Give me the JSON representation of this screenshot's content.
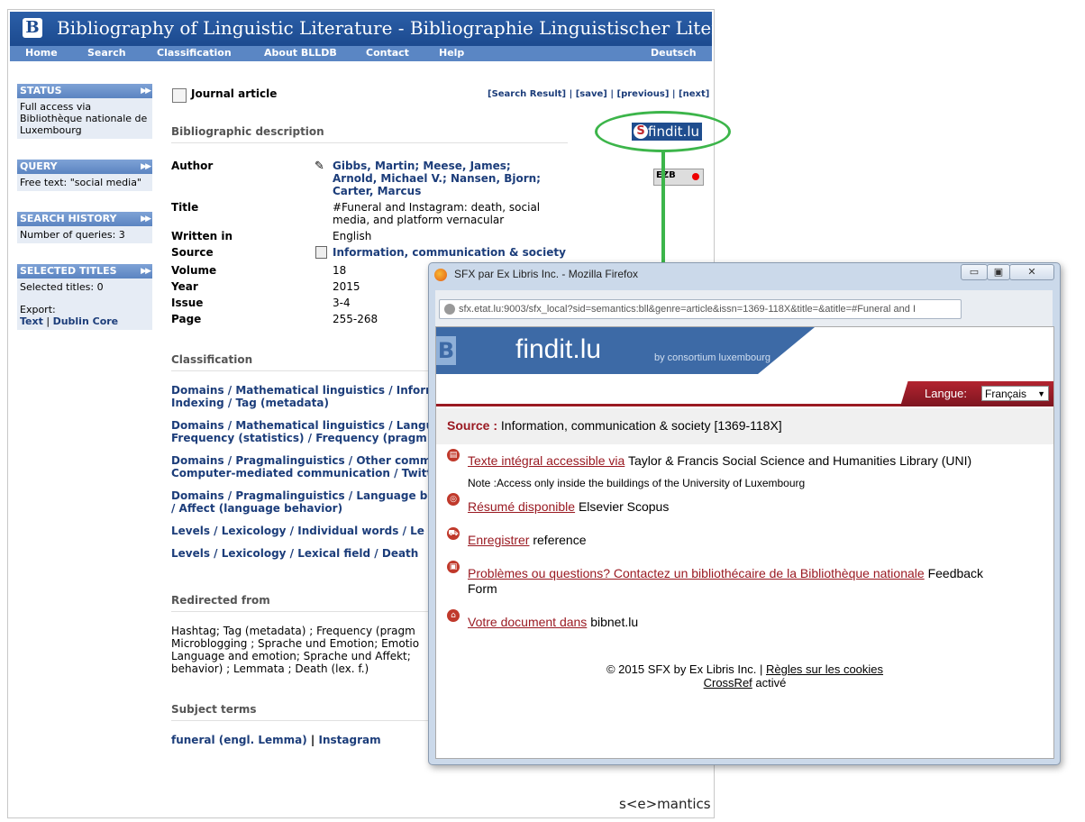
{
  "site": {
    "title": "Bibliography of Linguistic Literature - Bibliographie Linguistischer Literatur",
    "logo": "B"
  },
  "nav": {
    "home": "Home",
    "search": "Search",
    "classification": "Classification",
    "about": "About BLLDB",
    "contact": "Contact",
    "help": "Help",
    "lang": "Deutsch"
  },
  "sidebar": {
    "status": {
      "title": "STATUS",
      "text": "Full access via Bibliothèque nationale de Luxembourg"
    },
    "query": {
      "title": "QUERY",
      "text": "Free text: \"social media\""
    },
    "history": {
      "title": "SEARCH HISTORY",
      "text": "Number of queries: 3"
    },
    "selected": {
      "title": "SELECTED TITLES",
      "text": "Selected titles: 0",
      "export_label": "Export:",
      "export_text": "Text",
      "sep": "|",
      "export_dc": "Dublin Core"
    }
  },
  "record": {
    "type": "Journal article",
    "nav": {
      "result": "[Search Result]",
      "save": "[save]",
      "prev": "[previous]",
      "next": "[next]",
      "sep": "|"
    },
    "section_desc": "Bibliographic description",
    "fields": {
      "author_label": "Author",
      "author": "Gibbs, Martin; Meese, James; Arnold, Michael V.; Nansen, Bjorn; Carter, Marcus",
      "title_label": "Title",
      "title": "#Funeral and Instagram: death, social media, and platform vernacular",
      "lang_label": "Written in",
      "lang": "English",
      "source_label": "Source",
      "source": "Information, communication & society",
      "volume_label": "Volume",
      "volume": "18",
      "year_label": "Year",
      "year": "2015",
      "issue_label": "Issue",
      "issue": "3-4",
      "page_label": "Page",
      "page": "255-268"
    },
    "section_class": "Classification",
    "classifications": [
      {
        "line1": "Domains / Mathematical linguistics / Inform",
        "line2": "Indexing / Tag (metadata)"
      },
      {
        "line1": "Domains / Mathematical linguistics / Langu",
        "line2": "Frequency (statistics) / Frequency (pragm"
      },
      {
        "line1": "Domains / Pragmalinguistics / Other comm",
        "line2": "Computer-mediated communication / Twitt"
      },
      {
        "line1": "Domains / Pragmalinguistics / Language be",
        "line2": "/ Affect (language behavior)"
      },
      {
        "line1": "Levels / Lexicology / Individual words / Le",
        "line2": ""
      },
      {
        "line1": "Levels / Lexicology / Lexical field / Death",
        "line2": ""
      }
    ],
    "section_redirect": "Redirected from",
    "redirect_lines": [
      "Hashtag; Tag (metadata) ; Frequency (pragm",
      "Microblogging ; Sprache und Emotion; Emotio",
      "Language and emotion; Sprache und Affekt;",
      "behavior) ; Lemmata ; Death (lex. f.)"
    ],
    "section_subject": "Subject terms",
    "subject1": "funeral (engl. Lemma)",
    "subject_sep": "|",
    "subject2": "Instagram",
    "findit": "findit.lu",
    "findit_s": "S",
    "ezb": "EZB",
    "brand": "s<e>mantics"
  },
  "popup": {
    "title": "SFX par Ex Libris Inc. - Mozilla Firefox",
    "url": "sfx.etat.lu:9003/sfx_local?sid=semantics:bll&genre=article&issn=1369-118X&title=&atitle=#Funeral and I",
    "buttons": {
      "min": "▭",
      "max": "▣",
      "close": "✕"
    },
    "brand": "findit.lu",
    "brand_letter": "B",
    "consortium": "by consortium luxembourg",
    "lang_label": "Langue:",
    "lang_value": "Français",
    "source_label": "Source :",
    "source_value": "Information, communication & society [1369-118X]",
    "items": [
      {
        "link": "Texte intégral accessible via",
        "text": "Taylor & Francis Social Science and Humanities Library (UNI)"
      },
      {
        "link": "Résumé disponible",
        "text": "Elsevier Scopus"
      },
      {
        "link": "Enregistrer",
        "text": "reference"
      },
      {
        "link": "Problèmes ou questions? Contactez un bibliothécaire de la Bibliothèque nationale",
        "text": "Feedback"
      },
      {
        "link": "Votre document dans",
        "text": "bibnet.lu"
      }
    ],
    "note": "Note :Access only inside the buildings of the University of Luxembourg",
    "form_word": "Form",
    "footer_copy": "© 2015 SFX by Ex Libris Inc. |",
    "footer_rules": "Règles sur les cookies",
    "footer_crossref": "CrossRef",
    "footer_active": "activé"
  }
}
